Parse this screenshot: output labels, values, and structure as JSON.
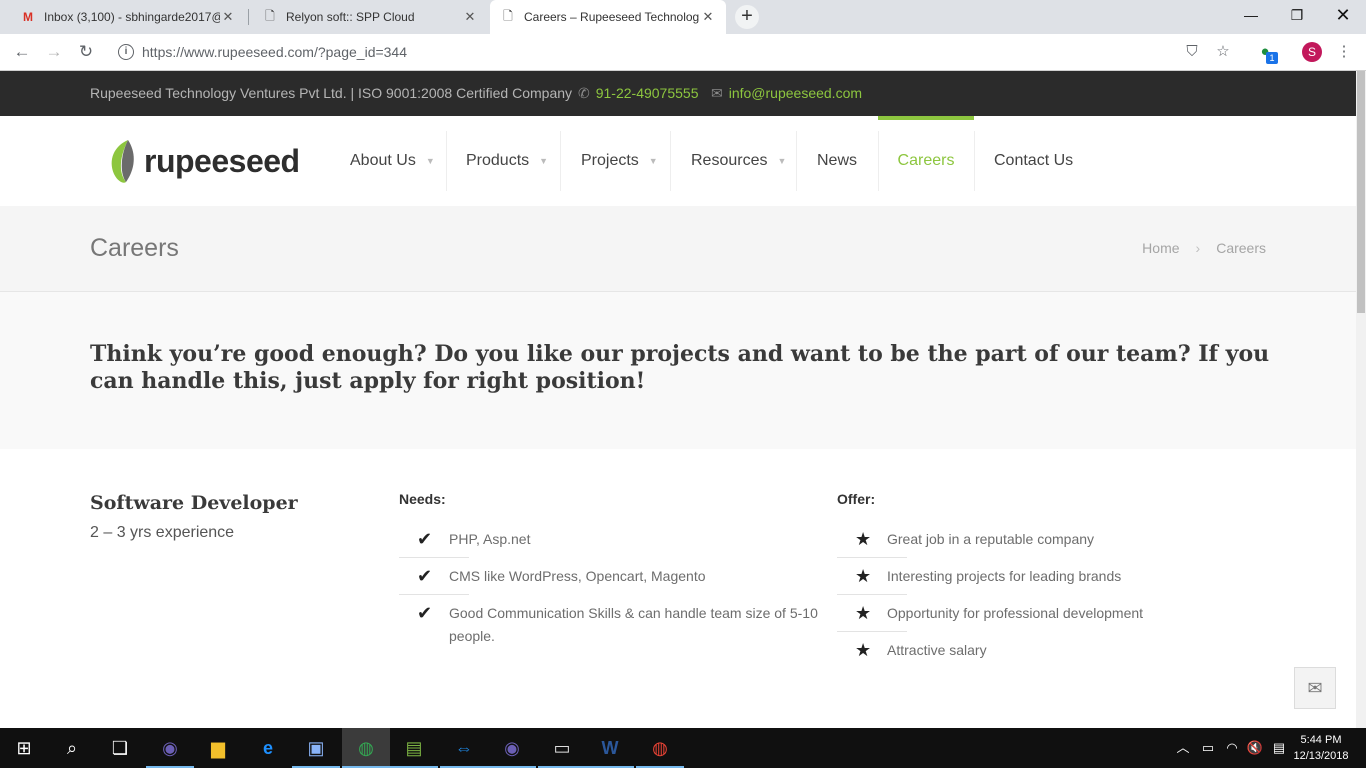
{
  "browser": {
    "tabs": [
      {
        "title": "Inbox (3,100) - sbhingarde2017@",
        "icon": "gmail-icon"
      },
      {
        "title": "Relyon soft:: SPP Cloud",
        "icon": "page-icon"
      },
      {
        "title": "Careers – Rupeeseed Technologie",
        "icon": "page-icon"
      }
    ],
    "new_tab": "+",
    "url": "https://www.rupeeseed.com/?page_id=344",
    "avatar_letter": "S",
    "extension_badge": "1"
  },
  "topbar": {
    "company": "Rupeeseed Technology Ventures Pvt Ltd. | ISO 9001:2008 Certified Company",
    "phone": "91-22-49075555",
    "email": "info@rupeeseed.com"
  },
  "logo": {
    "text": "rupeeseed"
  },
  "menu": [
    {
      "label": "About Us"
    },
    {
      "label": "Products"
    },
    {
      "label": "Projects"
    },
    {
      "label": "Resources"
    },
    {
      "label": "News"
    },
    {
      "label": "Careers"
    },
    {
      "label": "Contact Us"
    }
  ],
  "page_title": "Careers",
  "breadcrumb": {
    "home": "Home",
    "current": "Careers"
  },
  "hero_text": "Think you’re good enough? Do you like our projects and want to be the part of our team? If you can handle this, just apply for right position!",
  "job": {
    "title": "Software Developer",
    "experience": "2 – 3 yrs experience",
    "needs_heading": "Needs:",
    "needs": [
      "PHP, Asp.net",
      "CMS like WordPress, Opencart, Magento",
      "Good Communication Skills & can handle team size of 5-10 people."
    ],
    "offer_heading": "Offer:",
    "offers": [
      "Great job in a reputable company",
      "Interesting projects for leading brands",
      "Opportunity for professional development",
      "Attractive salary"
    ]
  },
  "taskbar": {
    "time": "5:44 PM",
    "date": "12/13/2018"
  },
  "colors": {
    "accent": "#8dc63f",
    "topbar_bg": "#2b2b2b"
  }
}
